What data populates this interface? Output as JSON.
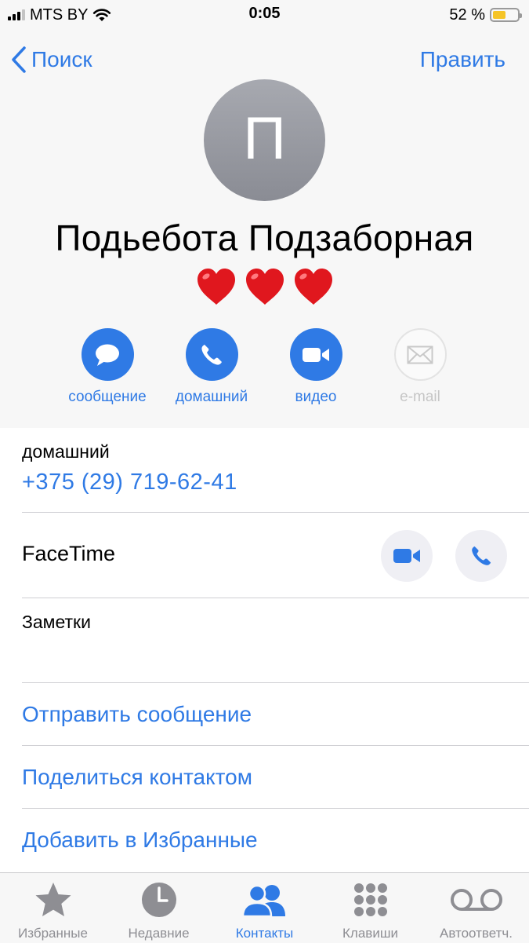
{
  "status_bar": {
    "carrier": "MTS BY",
    "time": "0:05",
    "battery_percent_text": "52 %",
    "battery_level": 0.52
  },
  "nav": {
    "back_label": "Поиск",
    "edit_label": "Править"
  },
  "contact": {
    "avatar_letter": "П",
    "name": "Подьебота Подзаборная",
    "hearts": [
      "❤",
      "❤",
      "❤"
    ]
  },
  "actions": [
    {
      "label": "сообщение",
      "icon": "message-bubble-icon",
      "enabled": true
    },
    {
      "label": "домашний",
      "icon": "phone-icon",
      "enabled": true
    },
    {
      "label": "видео",
      "icon": "video-camera-icon",
      "enabled": true
    },
    {
      "label": "e-mail",
      "icon": "envelope-icon",
      "enabled": false
    }
  ],
  "details": {
    "phone_label": "домашний",
    "phone_number": "+375 (29) 719-62-41",
    "facetime_label": "FaceTime",
    "notes_label": "Заметки"
  },
  "links": [
    "Отправить сообщение",
    "Поделиться контактом",
    "Добавить в Избранные"
  ],
  "tabs": [
    {
      "label": "Избранные",
      "icon": "star-icon",
      "active": false
    },
    {
      "label": "Недавние",
      "icon": "clock-icon",
      "active": false
    },
    {
      "label": "Контакты",
      "icon": "contacts-icon",
      "active": true
    },
    {
      "label": "Клавиши",
      "icon": "keypad-icon",
      "active": false
    },
    {
      "label": "Автоответч.",
      "icon": "voicemail-icon",
      "active": false
    }
  ],
  "colors": {
    "accent": "#2f7ae5",
    "header_bg": "#f7f7f7",
    "avatar": "#9a9ca3",
    "heart": "#e0171e",
    "inactive_tab": "#8e8e93"
  }
}
